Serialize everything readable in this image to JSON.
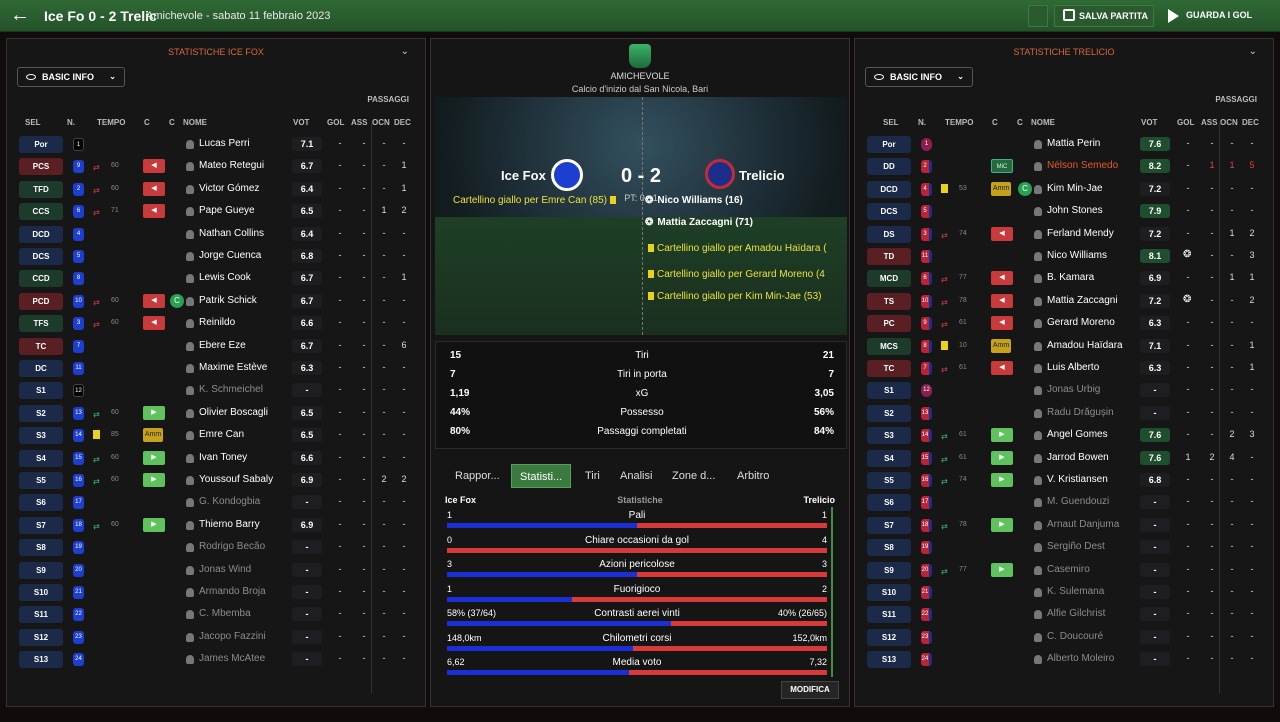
{
  "header": {
    "title": "Ice Fo 0 - 2 Trelic",
    "subtitle": "Amichevole - sabato 11 febbraio 2023",
    "save_label": "SALVA PARTITA",
    "watch_label": "GUARDA I GOL"
  },
  "home_panel": {
    "title": "STATISTICHE ICE FOX",
    "view": "BASIC INFO",
    "passes_label": "PASSAGGI",
    "columns": {
      "sel": "SEL",
      "n": "N.",
      "time": "TEMPO",
      "c1": "C",
      "c2": "C",
      "name": "NOME",
      "vot": "VOT",
      "gol": "GOL",
      "ass": "ASS",
      "ocn": "OCN",
      "dec": "DEC"
    },
    "players": [
      {
        "pos": "Por",
        "num": "1",
        "name": "Lucas Perri",
        "vot": "7.1",
        "gol": "-",
        "ass": "-",
        "ocn": "-",
        "dec": "-"
      },
      {
        "pos": "PCS",
        "num": "9",
        "sub": "60",
        "tag": "red",
        "name": "Mateo Retegui",
        "vot": "6.7",
        "gol": "-",
        "ass": "-",
        "ocn": "-",
        "dec": "1"
      },
      {
        "pos": "TFD",
        "num": "2",
        "sub": "60",
        "tag": "red",
        "name": "Victor Gómez",
        "vot": "6.4",
        "gol": "-",
        "ass": "-",
        "ocn": "-",
        "dec": "1"
      },
      {
        "pos": "CCS",
        "num": "6",
        "sub": "71",
        "tag": "red",
        "name": "Pape Gueye",
        "vot": "6.5",
        "gol": "-",
        "ass": "-",
        "ocn": "1",
        "dec": "2"
      },
      {
        "pos": "DCD",
        "num": "4",
        "name": "Nathan Collins",
        "vot": "6.4",
        "gol": "-",
        "ass": "-",
        "ocn": "-",
        "dec": "-"
      },
      {
        "pos": "DCS",
        "num": "5",
        "name": "Jorge Cuenca",
        "vot": "6.8",
        "gol": "-",
        "ass": "-",
        "ocn": "-",
        "dec": "-"
      },
      {
        "pos": "CCD",
        "num": "8",
        "name": "Lewis Cook",
        "vot": "6.7",
        "gol": "-",
        "ass": "-",
        "ocn": "-",
        "dec": "1"
      },
      {
        "pos": "PCD",
        "num": "10",
        "sub": "60",
        "tag": "red",
        "ball": true,
        "name": "Patrik Schick",
        "vot": "6.7",
        "gol": "-",
        "ass": "-",
        "ocn": "-",
        "dec": "-"
      },
      {
        "pos": "TFS",
        "num": "3",
        "sub": "60",
        "tag": "red",
        "name": "Reinildo",
        "vot": "6.6",
        "gol": "-",
        "ass": "-",
        "ocn": "-",
        "dec": "-"
      },
      {
        "pos": "TC",
        "num": "7",
        "name": "Ebere Eze",
        "vot": "6.7",
        "gol": "-",
        "ass": "-",
        "ocn": "-",
        "dec": "6"
      },
      {
        "pos": "DC",
        "num": "11",
        "name": "Maxime Estève",
        "vot": "6.3",
        "gol": "-",
        "ass": "-",
        "ocn": "-",
        "dec": "-"
      },
      {
        "pos": "S1",
        "num": "12",
        "name": "K. Schmeichel",
        "vot": "-",
        "gol": "-",
        "ass": "-",
        "ocn": "-",
        "dec": "-"
      },
      {
        "pos": "S2",
        "num": "13",
        "sub": "60",
        "tag": "green",
        "name": "Olivier Boscagli",
        "vot": "6.5",
        "gol": "-",
        "ass": "-",
        "ocn": "-",
        "dec": "-"
      },
      {
        "pos": "S3",
        "num": "14",
        "card": "yellow",
        "sub": "85",
        "tag": "amm",
        "name": "Emre Can",
        "vot": "6.5",
        "gol": "-",
        "ass": "-",
        "ocn": "-",
        "dec": "-"
      },
      {
        "pos": "S4",
        "num": "15",
        "sub": "60",
        "tag": "green",
        "name": "Ivan Toney",
        "vot": "6.6",
        "gol": "-",
        "ass": "-",
        "ocn": "-",
        "dec": "-"
      },
      {
        "pos": "S5",
        "num": "16",
        "sub": "60",
        "tag": "green",
        "name": "Youssouf Sabaly",
        "vot": "6.9",
        "gol": "-",
        "ass": "-",
        "ocn": "2",
        "dec": "2"
      },
      {
        "pos": "S6",
        "num": "17",
        "name": "G. Kondogbia",
        "vot": "-",
        "gol": "-",
        "ass": "-",
        "ocn": "-",
        "dec": "-"
      },
      {
        "pos": "S7",
        "num": "18",
        "sub": "60",
        "tag": "green",
        "name": "Thierno Barry",
        "vot": "6.9",
        "gol": "-",
        "ass": "-",
        "ocn": "-",
        "dec": "-"
      },
      {
        "pos": "S8",
        "num": "19",
        "name": "Rodrigo Becão",
        "vot": "-",
        "gol": "-",
        "ass": "-",
        "ocn": "-",
        "dec": "-"
      },
      {
        "pos": "S9",
        "num": "20",
        "name": "Jonas Wind",
        "vot": "-",
        "gol": "-",
        "ass": "-",
        "ocn": "-",
        "dec": "-"
      },
      {
        "pos": "S10",
        "num": "21",
        "name": "Armando Broja",
        "vot": "-",
        "gol": "-",
        "ass": "-",
        "ocn": "-",
        "dec": "-"
      },
      {
        "pos": "S11",
        "num": "22",
        "name": "C. Mbemba",
        "vot": "-",
        "gol": "-",
        "ass": "-",
        "ocn": "-",
        "dec": "-"
      },
      {
        "pos": "S12",
        "num": "23",
        "name": "Jacopo Fazzini",
        "vot": "-",
        "gol": "-",
        "ass": "-",
        "ocn": "-",
        "dec": "-"
      },
      {
        "pos": "S13",
        "num": "24",
        "name": "James McAtee",
        "vot": "-",
        "gol": "-",
        "ass": "-",
        "ocn": "-",
        "dec": "-"
      }
    ]
  },
  "away_panel": {
    "title": "STATISTICHE TRELICIO",
    "view": "BASIC INFO",
    "passes_label": "PASSAGGI",
    "columns": {
      "sel": "SEL",
      "n": "N.",
      "time": "TEMPO",
      "c1": "C",
      "c2": "C",
      "name": "NOME",
      "vot": "VOT",
      "gol": "GOL",
      "ass": "ASS",
      "ocn": "OCN",
      "dec": "DEC"
    },
    "players": [
      {
        "pos": "Por",
        "num": "1",
        "name": "Mattia Perin",
        "vot": "7.6",
        "gol": "-",
        "ass": "-",
        "ocn": "-",
        "dec": "-"
      },
      {
        "pos": "DD",
        "num": "2",
        "tag": "mic",
        "tag_text": "MiC",
        "name": "Nélson Semedo",
        "vot": "8.2",
        "gol": "-",
        "ass": "1",
        "ocn": "1",
        "dec": "5",
        "highlight": true
      },
      {
        "pos": "DCD",
        "num": "4",
        "card": "yellow",
        "sub": "53",
        "tag": "amm",
        "ball": true,
        "name": "Kim Min-Jae",
        "vot": "7.2",
        "gol": "-",
        "ass": "-",
        "ocn": "-",
        "dec": "-"
      },
      {
        "pos": "DCS",
        "num": "5",
        "name": "John Stones",
        "vot": "7.9",
        "gol": "-",
        "ass": "-",
        "ocn": "-",
        "dec": "-"
      },
      {
        "pos": "DS",
        "num": "3",
        "sub": "74",
        "tag": "red",
        "name": "Ferland Mendy",
        "vot": "7.2",
        "gol": "-",
        "ass": "-",
        "ocn": "1",
        "dec": "2"
      },
      {
        "pos": "TD",
        "num": "11",
        "name": "Nico Williams",
        "vot": "8.1",
        "goal": true,
        "gol": "-",
        "ass": "-",
        "ocn": "-",
        "dec": "3"
      },
      {
        "pos": "MCD",
        "num": "6",
        "sub": "77",
        "tag": "red",
        "name": "B. Kamara",
        "vot": "6.9",
        "gol": "-",
        "ass": "-",
        "ocn": "1",
        "dec": "1"
      },
      {
        "pos": "TS",
        "num": "10",
        "sub": "78",
        "tag": "red",
        "name": "Mattia Zaccagni",
        "vot": "7.2",
        "goal": true,
        "gol": "-",
        "ass": "-",
        "ocn": "-",
        "dec": "2"
      },
      {
        "pos": "PC",
        "num": "9",
        "sub": "61",
        "tag": "red",
        "name": "Gerard Moreno",
        "vot": "6.3",
        "gol": "-",
        "ass": "-",
        "ocn": "-",
        "dec": "-"
      },
      {
        "pos": "MCS",
        "num": "8",
        "card": "yellow",
        "sub": "10",
        "tag": "amm",
        "name": "Amadou Haïdara",
        "vot": "7.1",
        "gol": "-",
        "ass": "-",
        "ocn": "-",
        "dec": "1"
      },
      {
        "pos": "TC",
        "num": "7",
        "sub": "61",
        "tag": "red",
        "name": "Luis Alberto",
        "vot": "6.3",
        "gol": "-",
        "ass": "-",
        "ocn": "-",
        "dec": "1"
      },
      {
        "pos": "S1",
        "num": "12",
        "name": "Jonas Urbig",
        "vot": "-",
        "gol": "-",
        "ass": "-",
        "ocn": "-",
        "dec": "-"
      },
      {
        "pos": "S2",
        "num": "13",
        "name": "Radu Drăgușin",
        "vot": "-",
        "gol": "-",
        "ass": "-",
        "ocn": "-",
        "dec": "-"
      },
      {
        "pos": "S3",
        "num": "14",
        "sub": "61",
        "tag": "green",
        "name": "Angel Gomes",
        "vot": "7.6",
        "gol": "-",
        "ass": "-",
        "ocn": "2",
        "dec": "3"
      },
      {
        "pos": "S4",
        "num": "15",
        "sub": "61",
        "tag": "green",
        "name": "Jarrod Bowen",
        "vot": "7.6",
        "gol": "1",
        "ass": "2",
        "ocn": "4",
        "dec": "-"
      },
      {
        "pos": "S5",
        "num": "16",
        "sub": "74",
        "tag": "green",
        "name": "V. Kristiansen",
        "vot": "6.8",
        "gol": "-",
        "ass": "-",
        "ocn": "-",
        "dec": "-"
      },
      {
        "pos": "S6",
        "num": "17",
        "name": "M. Guendouzi",
        "vot": "-",
        "gol": "-",
        "ass": "-",
        "ocn": "-",
        "dec": "-"
      },
      {
        "pos": "S7",
        "num": "18",
        "sub": "78",
        "tag": "green",
        "name": "Arnaut Danjuma",
        "vot": "-",
        "gol": "-",
        "ass": "-",
        "ocn": "-",
        "dec": "-"
      },
      {
        "pos": "S8",
        "num": "19",
        "name": "Sergiño Dest",
        "vot": "-",
        "gol": "-",
        "ass": "-",
        "ocn": "-",
        "dec": "-"
      },
      {
        "pos": "S9",
        "num": "20",
        "sub": "77",
        "tag": "green",
        "name": "Casemiro",
        "vot": "-",
        "gol": "-",
        "ass": "-",
        "ocn": "-",
        "dec": "-"
      },
      {
        "pos": "S10",
        "num": "21",
        "name": "K. Sulemana",
        "vot": "-",
        "gol": "-",
        "ass": "-",
        "ocn": "-",
        "dec": "-"
      },
      {
        "pos": "S11",
        "num": "22",
        "name": "Alfie Gilchrist",
        "vot": "-",
        "gol": "-",
        "ass": "-",
        "ocn": "-",
        "dec": "-"
      },
      {
        "pos": "S12",
        "num": "23",
        "name": "C. Doucouré",
        "vot": "-",
        "gol": "-",
        "ass": "-",
        "ocn": "-",
        "dec": "-"
      },
      {
        "pos": "S13",
        "num": "24",
        "name": "Alberto Moleiro",
        "vot": "-",
        "gol": "-",
        "ass": "-",
        "ocn": "-",
        "dec": "-"
      }
    ]
  },
  "center": {
    "competition": "AMICHEVOLE",
    "venue": "Calcio d'inizio dal San Nicola, Bari",
    "home_team": "Ice Fox",
    "away_team": "Trelicio",
    "score": "0 - 2",
    "half_time": "PT: 0 - 1",
    "events_home": [
      "Cartellino giallo per Emre Can (85)"
    ],
    "events_away": [
      {
        "text": "Nico Williams (16)",
        "goal": true
      },
      {
        "text": "Mattia Zaccagni (71)",
        "goal": true
      },
      {
        "text": "Cartellino giallo per Amadou Haïdara (",
        "goal": false
      },
      {
        "text": "Cartellino giallo per Gerard Moreno (4",
        "goal": false
      },
      {
        "text": "Cartellino giallo per Kim Min-Jae (53)",
        "goal": false
      }
    ],
    "summary": [
      {
        "l": "15",
        "m": "Tiri",
        "r": "21"
      },
      {
        "l": "7",
        "m": "Tiri in porta",
        "r": "7"
      },
      {
        "l": "1,19",
        "m": "xG",
        "r": "3,05"
      },
      {
        "l": "44%",
        "m": "Possesso",
        "r": "56%"
      },
      {
        "l": "80%",
        "m": "Passaggi completati",
        "r": "84%"
      }
    ],
    "tabs": [
      "Rappor...",
      "Statisti...",
      "Tiri",
      "Analisi",
      "Zone d...",
      "Arbitro"
    ],
    "stats_header": {
      "left": "Ice Fox",
      "mid": "Statistiche",
      "right": "Trelicio"
    },
    "bar_stats": [
      {
        "l": "1",
        "m": "Pali",
        "r": "1",
        "home_share": 0.5
      },
      {
        "l": "0",
        "m": "Chiare occasioni da gol",
        "r": "4",
        "home_share": 0.0
      },
      {
        "l": "3",
        "m": "Azioni pericolose",
        "r": "3",
        "home_share": 0.5
      },
      {
        "l": "1",
        "m": "Fuorigioco",
        "r": "2",
        "home_share": 0.33
      },
      {
        "l": "58% (37/64)",
        "m": "Contrasti aerei vinti",
        "r": "40% (26/65)",
        "home_share": 0.59
      },
      {
        "l": "148,0km",
        "m": "Chilometri corsi",
        "r": "152,0km",
        "home_share": 0.49
      },
      {
        "l": "6,62",
        "m": "Media voto",
        "r": "7,32",
        "home_share": 0.48
      }
    ],
    "modify_label": "MODIFICA"
  },
  "colors": {
    "accent": "#2f6a34",
    "home": "#1a2fd6",
    "away": "#d83a3a",
    "title_orange": "#d86a3a"
  }
}
